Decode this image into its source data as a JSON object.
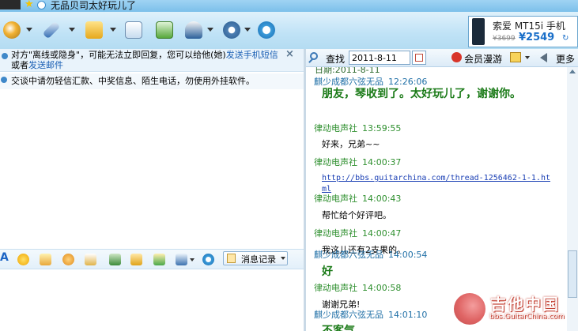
{
  "window": {
    "title": "无品贝司太好玩儿了"
  },
  "toolbar": {
    "buttons": [
      "video-chat-icon",
      "voice-chat-icon",
      "send-file-icon",
      "send-email-icon",
      "add-app-icon",
      "group-icon",
      "settings-icon",
      "app-store-icon"
    ]
  },
  "ad": {
    "name": "索爱 MT15i 手机",
    "old_price": "¥3699",
    "new_price": "¥2549"
  },
  "notice": {
    "text_part1": "对方\"离线或隐身\"，可能无法立即回复，您可以给他(她)",
    "link1": "发送手机短信",
    "text_part2": "或者",
    "link2": "发送邮件"
  },
  "warning": {
    "text": "交谈中请勿轻信汇款、中奖信息、陌生电话，勿使用外挂软件。"
  },
  "input_toolbar": {
    "history_label": "消息记录"
  },
  "history": {
    "find_label": "查找",
    "date_value": "2011-8-11",
    "vip_label": "会员漫游",
    "more_label": "更多",
    "date_header": "日期:2011-8-11",
    "messages": [
      {
        "sender": "麒少成都六弦无品",
        "time": "12:26:06",
        "text": "朋友，琴收到了。太好玩儿了，谢谢你。",
        "style": "big"
      },
      {
        "sender": "律动电声社",
        "time": "13:59:55",
        "text": "好来，兄弟~~",
        "style": "plain"
      },
      {
        "sender": "律动电声社",
        "time": "14:00:37",
        "text": "http://bbs.guitarchina.com/thread-1256462-1-1.html",
        "style": "url"
      },
      {
        "sender": "律动电声社",
        "time": "14:00:43",
        "text": "帮忙给个好评吧。",
        "style": "plain"
      },
      {
        "sender": "律动电声社",
        "time": "14:00:47",
        "text": "我这儿还有2支果的。",
        "style": "plain"
      },
      {
        "sender": "麒少成都六弦无品",
        "time": "14:00:54",
        "text": "好",
        "style": "big"
      },
      {
        "sender": "律动电声社",
        "time": "14:00:58",
        "text": "谢谢兄弟!",
        "style": "plain"
      },
      {
        "sender": "麒少成都六弦无品",
        "time": "14:01:10",
        "text": "不客气",
        "style": "big"
      }
    ]
  },
  "watermark": {
    "name": "吉他中国",
    "url": "bbs.GuitarChina.com"
  }
}
